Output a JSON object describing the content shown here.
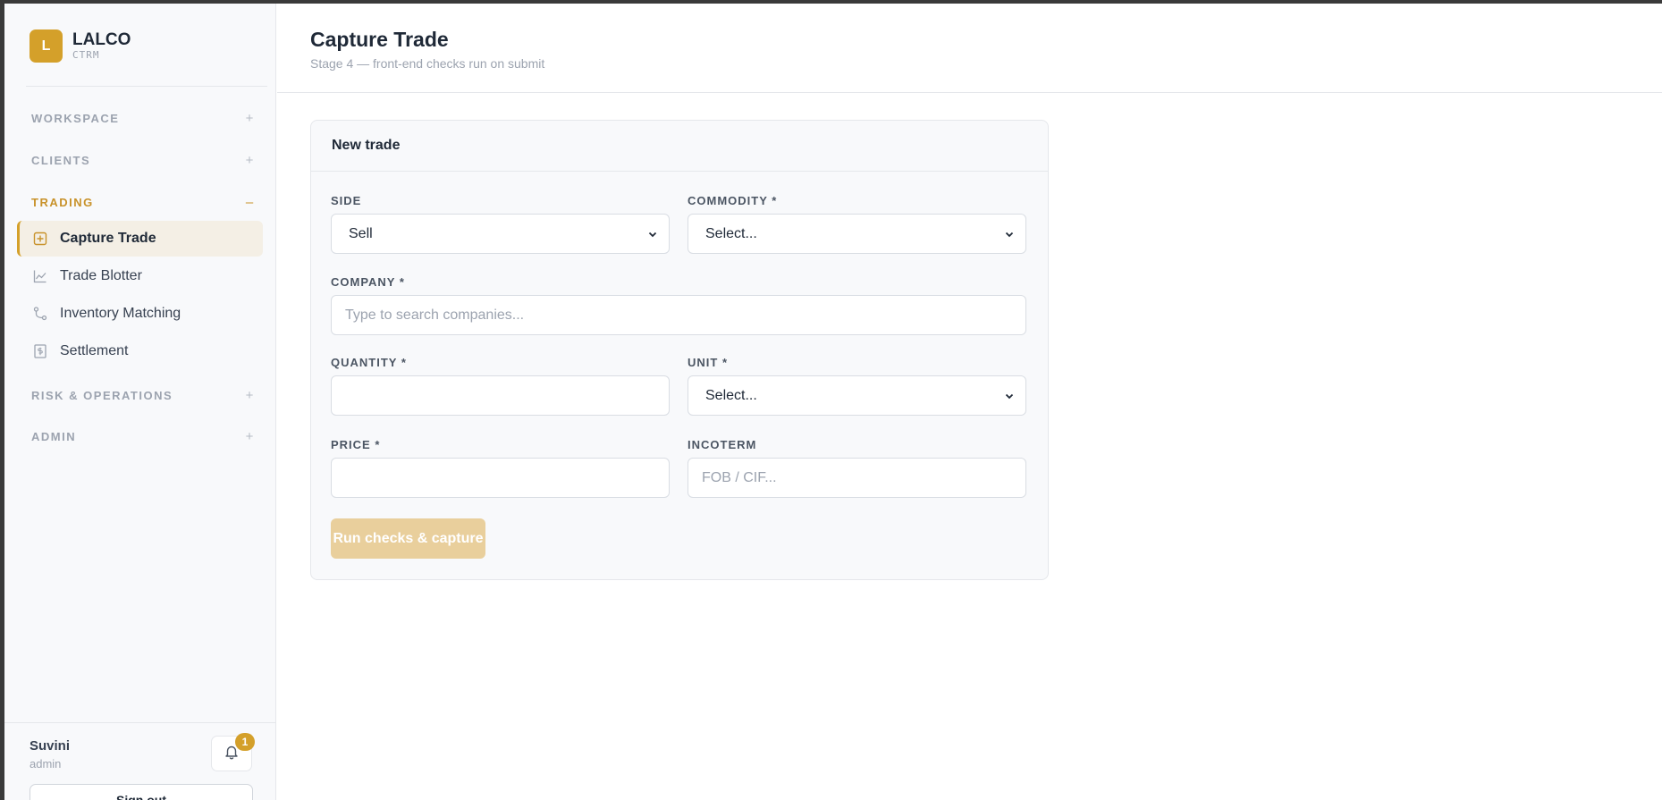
{
  "brand": {
    "logo_letter": "L",
    "name": "LALCO",
    "sub": "CTRM"
  },
  "sidebar": {
    "sections": [
      {
        "label": "WORKSPACE",
        "toggle": "+"
      },
      {
        "label": "CLIENTS",
        "toggle": "+"
      },
      {
        "label": "TRADING",
        "toggle": "–"
      },
      {
        "label": "RISK & OPERATIONS",
        "toggle": "+"
      },
      {
        "label": "ADMIN",
        "toggle": "+"
      }
    ],
    "trading_items": [
      {
        "label": "Capture Trade",
        "icon": "plus-square-icon",
        "active": true
      },
      {
        "label": "Trade Blotter",
        "icon": "line-chart-icon"
      },
      {
        "label": "Inventory Matching",
        "icon": "git-branch-icon"
      },
      {
        "label": "Settlement",
        "icon": "receipt-icon"
      }
    ]
  },
  "user": {
    "name": "Suvini",
    "role": "admin",
    "notifications": "1",
    "signout_label": "Sign out"
  },
  "header": {
    "title": "Capture Trade",
    "subtitle": "Stage 4 — front-end checks run on submit"
  },
  "form": {
    "title": "New trade",
    "side": {
      "label": "SIDE",
      "value": "Sell"
    },
    "commodity": {
      "label": "COMMODITY *",
      "value": "Select..."
    },
    "company": {
      "label": "COMPANY *",
      "placeholder": "Type to search companies..."
    },
    "quantity": {
      "label": "QUANTITY *",
      "value": ""
    },
    "unit": {
      "label": "UNIT *",
      "value": "Select..."
    },
    "price": {
      "label": "PRICE *",
      "value": ""
    },
    "incoterm": {
      "label": "INCOTERM",
      "placeholder": "FOB / CIF..."
    },
    "submit_label": "Run checks & capture"
  },
  "colors": {
    "accent": "#d4a02a",
    "accent_disabled": "#e9cf9c",
    "active_bg": "#f4efe5"
  }
}
